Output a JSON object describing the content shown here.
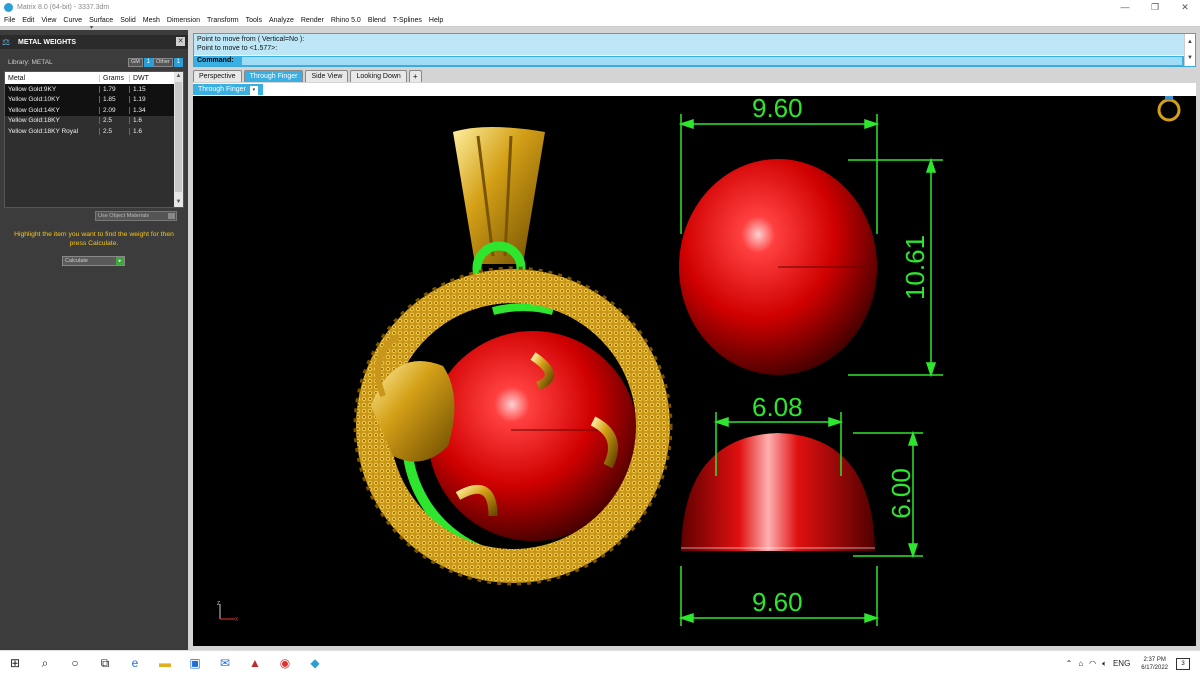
{
  "window": {
    "title": "Matrix 8.0 (64-bit) - 3337.3dm",
    "min": "—",
    "max": "❐",
    "close": "✕"
  },
  "menu": [
    "File",
    "Edit",
    "View",
    "Curve",
    "Surface",
    "Solid",
    "Mesh",
    "Dimension",
    "Transform",
    "Tools",
    "Analyze",
    "Render",
    "Rhino 5.0",
    "Blend",
    "T-Splines",
    "Help"
  ],
  "panel": {
    "title": "METAL WEIGHTS",
    "library": "Library: METAL",
    "toggle_gm": "GM",
    "toggle_other": "Other",
    "columns": [
      "Metal",
      "Grams",
      "DWT"
    ],
    "rows": [
      {
        "metal": "Yellow Gold:9KY",
        "grams": "1.79",
        "dwt": "1.15"
      },
      {
        "metal": "Yellow Gold:10KY",
        "grams": "1.85",
        "dwt": "1.19"
      },
      {
        "metal": "Yellow Gold:14KY",
        "grams": "2.09",
        "dwt": "1.34"
      },
      {
        "metal": "Yellow Gold:18KY",
        "grams": "2.5",
        "dwt": "1.6"
      },
      {
        "metal": "Yellow Gold:18KY Royal",
        "grams": "2.5",
        "dwt": "1.6"
      }
    ],
    "use_object_materials": "Use Object Materials",
    "hint": "Highlight the item you want to find the weight for then press Calculate.",
    "calculate": "Calculate"
  },
  "command": {
    "line1": "Point to move from ( Vertical=No ):",
    "line2": "Point to move to <1.577>:",
    "prompt": "Command:"
  },
  "tabs": [
    "Perspective",
    "Through Finger",
    "Side View",
    "Looking Down",
    "+"
  ],
  "viewport": {
    "label": "Through Finger",
    "dims": {
      "top_width": "9.60",
      "height_top": "10.61",
      "inner_width": "6.08",
      "height_bottom": "6.00",
      "bottom_width": "9.60"
    },
    "axis_z": "Z",
    "axis_x": "X"
  },
  "taskbar": {
    "lang": "ENG",
    "time": "2:37 PM",
    "date": "6/17/2022",
    "notif_count": "3"
  },
  "colors": {
    "dimension": "#2ee62e",
    "gem": "#e01010",
    "gold": "#d4a017",
    "accent": "#3ab0e2"
  }
}
